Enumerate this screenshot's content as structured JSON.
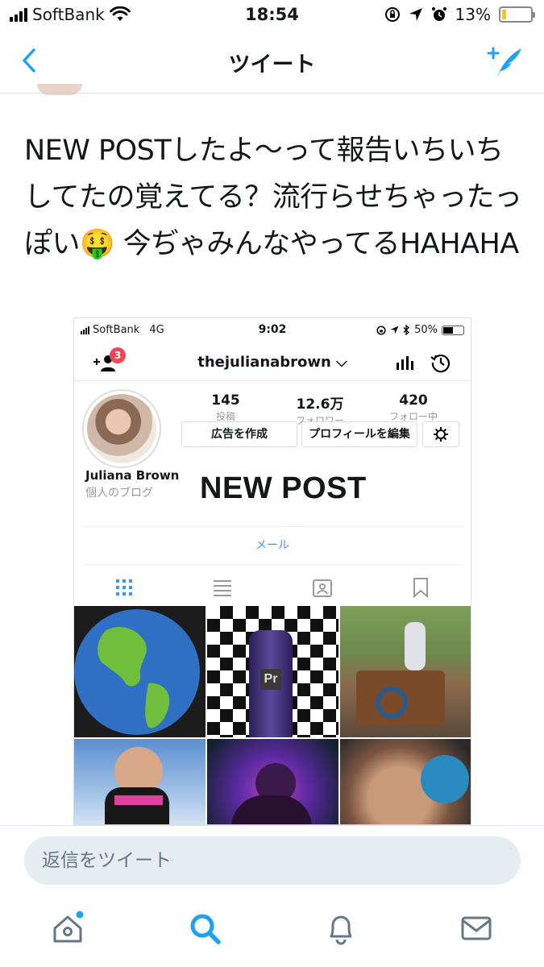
{
  "status_bar": {
    "carrier": "SoftBank",
    "time": "18:54",
    "battery": "13%",
    "battery_level": 0.13,
    "icons": [
      "signal-icon",
      "wifi-icon",
      "rotation-lock-icon",
      "location-icon",
      "alarm-icon",
      "battery-icon"
    ]
  },
  "nav": {
    "title": "ツイート",
    "back_icon": "chevron-left-icon",
    "compose_icon": "compose-tweet-icon"
  },
  "tweet": {
    "text": "NEW POSTしたよ〜って報告いちいちしてたの覚えてる？流行らせちゃったっぽい🤑 今ぢゃみんなやってるHAHAHA"
  },
  "embed": {
    "status": {
      "carrier": "SoftBank",
      "network": "4G",
      "time": "9:02",
      "battery": "50%",
      "battery_level": 0.5
    },
    "header": {
      "username": "thejulianabrown ⌵",
      "notification_badge": "3"
    },
    "stats": [
      {
        "value": "145",
        "label": "投稿"
      },
      {
        "value": "12.6万",
        "label": "フォロワー"
      },
      {
        "value": "420",
        "label": "フォロー中"
      }
    ],
    "buttons": {
      "promote": "広告を作成",
      "edit_profile": "プロフィールを編集"
    },
    "profile": {
      "name": "Juliana Brown",
      "bio": "個人のブログ",
      "overlay": "NEW POST"
    },
    "contact": "メール",
    "tabs": [
      "grid-icon",
      "list-icon",
      "tagged-icon",
      "bookmark-icon"
    ],
    "accent": "#3897f0"
  },
  "reply": {
    "placeholder": "返信をツイート"
  },
  "tabbar": {
    "items": [
      "home-icon",
      "search-icon",
      "notifications-icon",
      "messages-icon"
    ],
    "accent": "#1da1f2"
  }
}
